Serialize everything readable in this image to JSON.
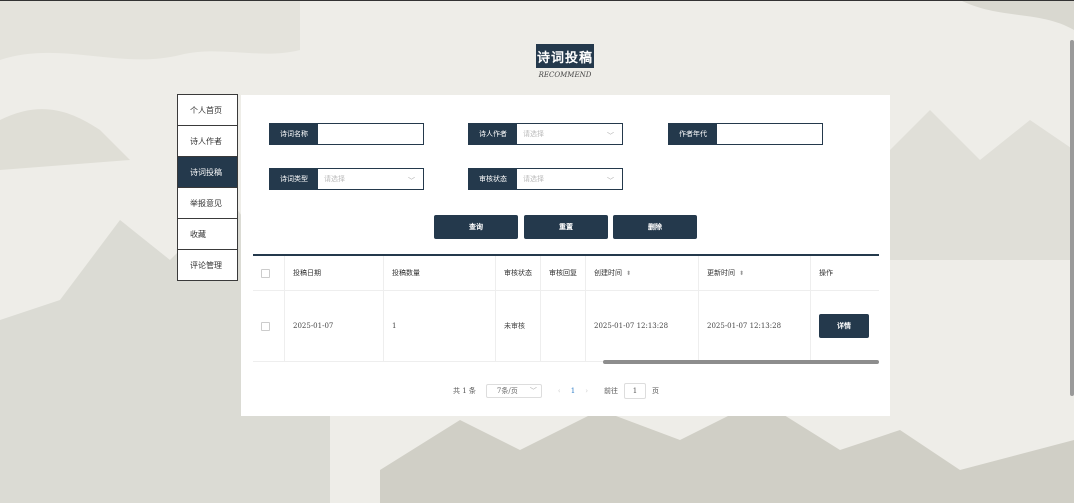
{
  "header": {
    "title": "诗词投稿",
    "subtitle": "RECOMMEND"
  },
  "sidebar": {
    "items": [
      {
        "label": "个人首页"
      },
      {
        "label": "诗人作者"
      },
      {
        "label": "诗词投稿",
        "active": true
      },
      {
        "label": "举报意见"
      },
      {
        "label": "收藏"
      },
      {
        "label": "评论管理"
      }
    ]
  },
  "filters": {
    "poem_name": {
      "label": "诗词名称",
      "value": ""
    },
    "poet": {
      "label": "诗人作者",
      "placeholder": "请选择"
    },
    "era": {
      "label": "作者年代",
      "value": ""
    },
    "poem_type": {
      "label": "诗词类型",
      "placeholder": "请选择"
    },
    "review_status": {
      "label": "审核状态",
      "placeholder": "请选择"
    }
  },
  "actions": {
    "query": "查询",
    "reset": "重置",
    "delete": "删除"
  },
  "table": {
    "columns": [
      "投稿日期",
      "投稿数量",
      "审核状态",
      "审核回复",
      "创建时间",
      "更新时间",
      "操作"
    ],
    "rows": [
      {
        "date": "2025-01-07",
        "count": "1",
        "status": "未审核",
        "reply": "",
        "created": "2025-01-07 12:13:28",
        "updated": "2025-01-07 12:13:28",
        "action": "详情"
      }
    ]
  },
  "pagination": {
    "total": "共 1 条",
    "page_size": "7条/页",
    "current": "1",
    "goto_prefix": "前往",
    "goto_value": "1",
    "goto_suffix": "页"
  },
  "colors": {
    "primary": "#24394c",
    "background": "#eeede8",
    "link": "#2d7cc6"
  }
}
